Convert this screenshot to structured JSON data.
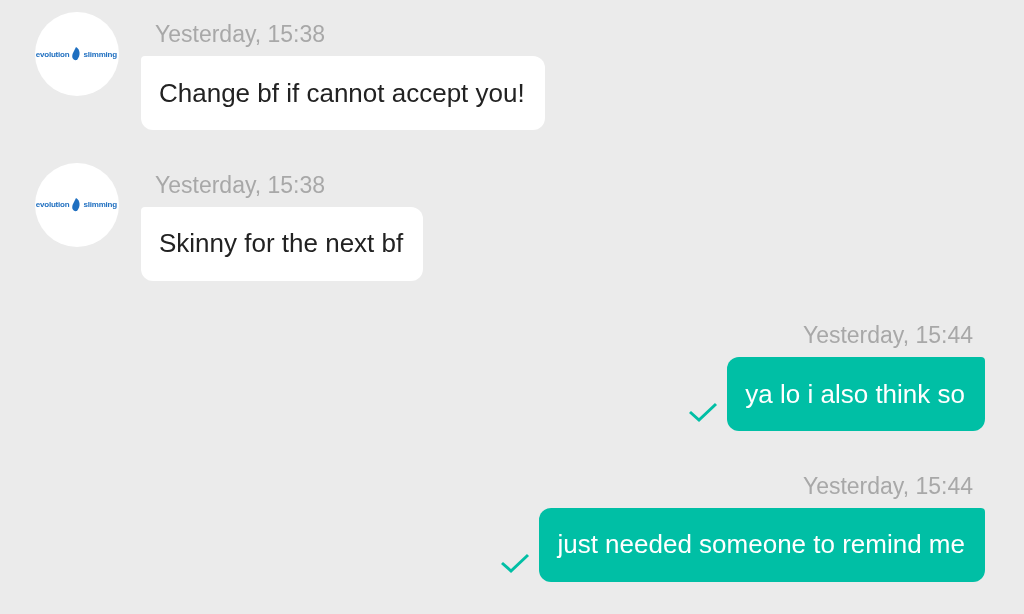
{
  "messages": [
    {
      "kind": "incoming",
      "avatar": {
        "logo_left": "evolution",
        "logo_right": "slimming"
      },
      "time": "Yesterday, 15:38",
      "text": "Change bf if cannot accept you!"
    },
    {
      "kind": "incoming",
      "avatar": {
        "logo_left": "evolution",
        "logo_right": "slimming"
      },
      "time": "Yesterday, 15:38",
      "text": "Skinny for the next bf"
    },
    {
      "kind": "outgoing",
      "time": "Yesterday, 15:44",
      "text": "ya lo i also think so",
      "delivered": true
    },
    {
      "kind": "outgoing",
      "time": "Yesterday, 15:44",
      "text": "just needed someone to remind me",
      "delivered": true
    }
  ]
}
